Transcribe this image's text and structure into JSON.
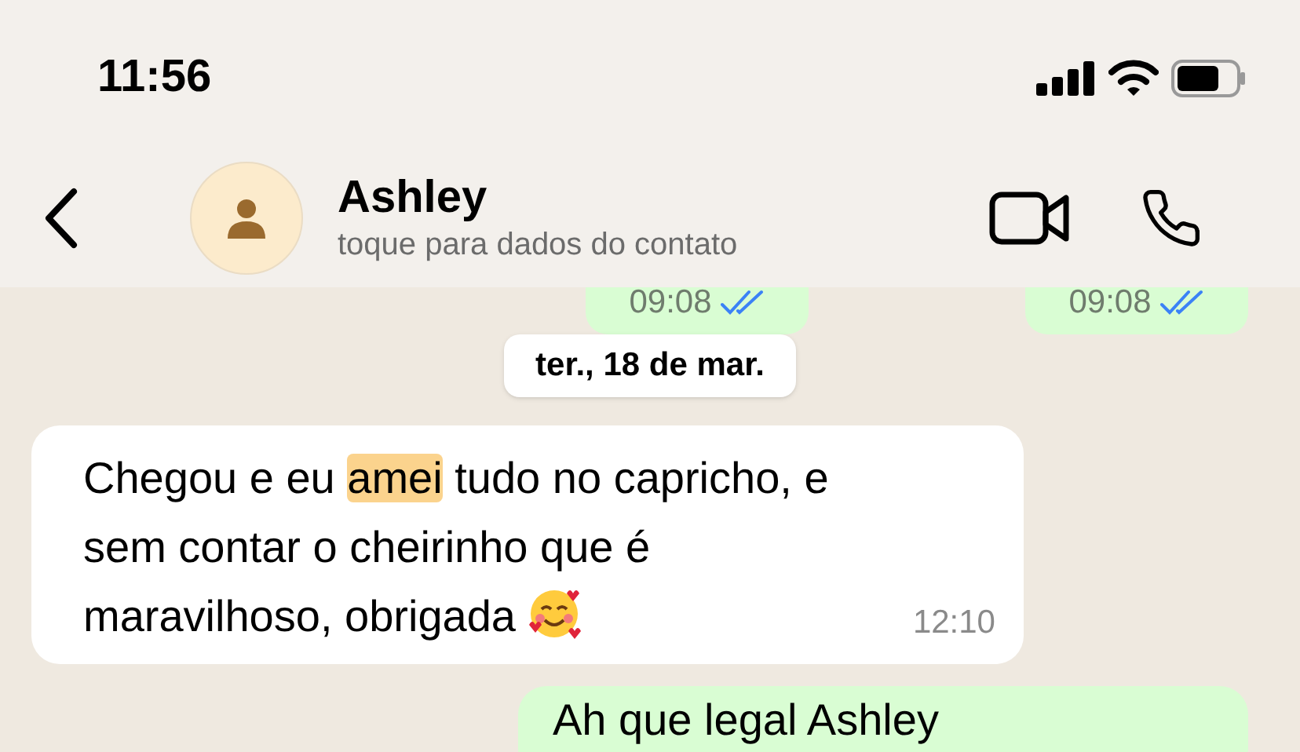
{
  "status_bar": {
    "time": "11:56"
  },
  "header": {
    "name": "Ashley",
    "subtitle": "toque para dados do contato"
  },
  "top_messages": [
    {
      "kind": "sent",
      "time": "09:08",
      "read": true
    },
    {
      "kind": "sent",
      "time": "09:08",
      "read": true
    }
  ],
  "date_divider": "ter., 18 de mar.",
  "messages": [
    {
      "kind": "received",
      "time": "12:10",
      "text_parts": [
        {
          "text": "Chegou e eu ",
          "highlighted": false
        },
        {
          "text": "amei",
          "highlighted": true
        },
        {
          "text": " tudo no capricho, e sem contar o cheirinho que é maravilhoso, obrigada",
          "highlighted": false
        }
      ]
    },
    {
      "kind": "sent",
      "text_parts": [
        {
          "text": "Ah que legal Ashley",
          "highlighted": false
        }
      ]
    }
  ]
}
